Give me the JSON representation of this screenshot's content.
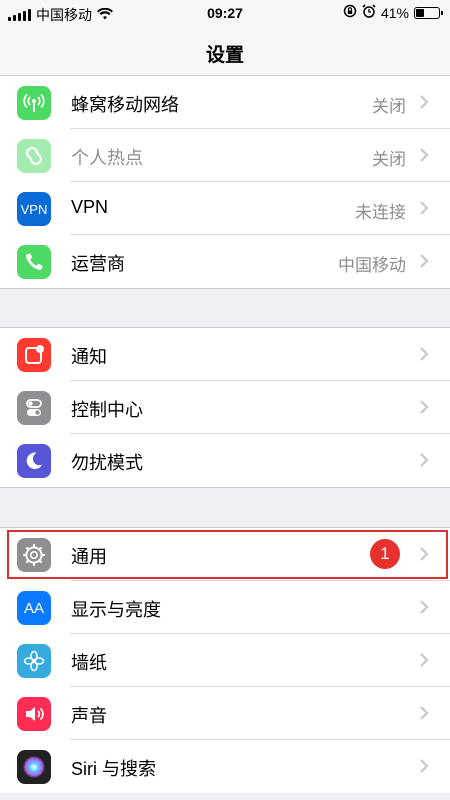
{
  "status_bar": {
    "carrier": "中国移动",
    "time": "09:27",
    "battery_percent": "41%",
    "battery_level": 0.41
  },
  "nav": {
    "title": "设置"
  },
  "groups": [
    {
      "items": [
        {
          "label": "蜂窝移动网络",
          "value": "关闭",
          "icon": "cellular-antenna-icon",
          "color": "#4cd964"
        },
        {
          "label": "个人热点",
          "value": "关闭",
          "icon": "personal-hotspot-icon",
          "color": "#4cd964",
          "disabled": true
        },
        {
          "label": "VPN",
          "value": "未连接",
          "icon": "vpn-icon",
          "icon_text": "VPN",
          "color": "#0a6bd8"
        },
        {
          "label": "运营商",
          "value": "中国移动",
          "icon": "phone-icon",
          "color": "#4cd964"
        }
      ]
    },
    {
      "items": [
        {
          "label": "通知",
          "icon": "notifications-icon",
          "color": "#ff3b30"
        },
        {
          "label": "控制中心",
          "icon": "control-center-icon",
          "color": "#8e8e93"
        },
        {
          "label": "勿扰模式",
          "icon": "moon-icon",
          "color": "#5856d6"
        }
      ]
    },
    {
      "items": [
        {
          "label": "通用",
          "icon": "gear-icon",
          "color": "#8e8e93",
          "badge": "1"
        },
        {
          "label": "显示与亮度",
          "icon": "display-brightness-icon",
          "icon_text": "AA",
          "color": "#0a7aff"
        },
        {
          "label": "墙纸",
          "icon": "wallpaper-flower-icon",
          "color": "#35aadc"
        },
        {
          "label": "声音",
          "icon": "speaker-icon",
          "color": "#ff2d55"
        },
        {
          "label": "Siri 与搜索",
          "icon": "siri-icon",
          "color": "#222"
        }
      ]
    }
  ]
}
